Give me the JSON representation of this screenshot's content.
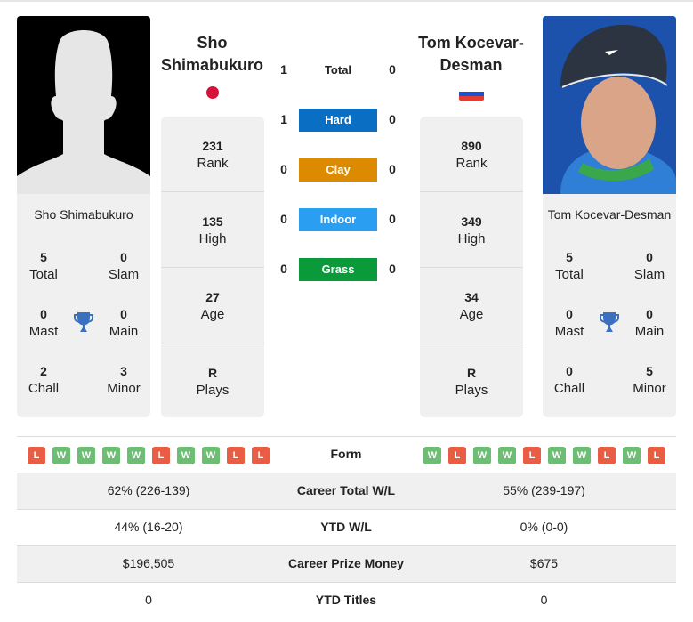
{
  "player1": {
    "name": "Sho Shimabukuro",
    "name_head_line1": "Sho",
    "name_head_line2": "Shimabukuro",
    "flag": "japan-flag",
    "titles": {
      "total": "5",
      "total_label": "Total",
      "slam": "0",
      "slam_label": "Slam",
      "mast": "0",
      "mast_label": "Mast",
      "main": "0",
      "main_label": "Main",
      "chall": "2",
      "chall_label": "Chall",
      "minor": "3",
      "minor_label": "Minor"
    },
    "stats": [
      {
        "value": "231",
        "label": "Rank"
      },
      {
        "value": "135",
        "label": "High"
      },
      {
        "value": "27",
        "label": "Age"
      },
      {
        "value": "R",
        "label": "Plays"
      }
    ],
    "form": [
      "L",
      "W",
      "W",
      "W",
      "W",
      "L",
      "W",
      "W",
      "L",
      "L"
    ],
    "career_wl": "62% (226-139)",
    "ytd_wl": "44% (16-20)",
    "prize": "$196,505",
    "ytd_titles": "0"
  },
  "player2": {
    "name": "Tom Kocevar-Desman",
    "name_head_line1": "Tom Kocevar-",
    "name_head_line2": "Desman",
    "flag": "slovenia-flag",
    "titles": {
      "total": "5",
      "total_label": "Total",
      "slam": "0",
      "slam_label": "Slam",
      "mast": "0",
      "mast_label": "Mast",
      "main": "0",
      "main_label": "Main",
      "chall": "0",
      "chall_label": "Chall",
      "minor": "5",
      "minor_label": "Minor"
    },
    "stats": [
      {
        "value": "890",
        "label": "Rank"
      },
      {
        "value": "349",
        "label": "High"
      },
      {
        "value": "34",
        "label": "Age"
      },
      {
        "value": "R",
        "label": "Plays"
      }
    ],
    "form": [
      "W",
      "L",
      "W",
      "W",
      "L",
      "W",
      "W",
      "L",
      "W",
      "L"
    ],
    "career_wl": "55% (239-197)",
    "ytd_wl": "0% (0-0)",
    "prize": "$675",
    "ytd_titles": "0"
  },
  "h2h": [
    {
      "surface": "Total",
      "p1": "1",
      "p2": "0",
      "color": ""
    },
    {
      "surface": "Hard",
      "p1": "1",
      "p2": "0",
      "color": "#0a6fc2"
    },
    {
      "surface": "Clay",
      "p1": "0",
      "p2": "0",
      "color": "#dc8b00"
    },
    {
      "surface": "Indoor",
      "p1": "0",
      "p2": "0",
      "color": "#2a9ef0"
    },
    {
      "surface": "Grass",
      "p1": "0",
      "p2": "0",
      "color": "#0a9a3a"
    }
  ],
  "table": {
    "form_label": "Form",
    "career_label": "Career Total W/L",
    "ytd_label": "YTD W/L",
    "prize_label": "Career Prize Money",
    "titles_label": "YTD Titles"
  },
  "colors": {
    "win": "#6dbd74",
    "loss": "#ea5d45",
    "trophy": "#3b6fc0"
  }
}
